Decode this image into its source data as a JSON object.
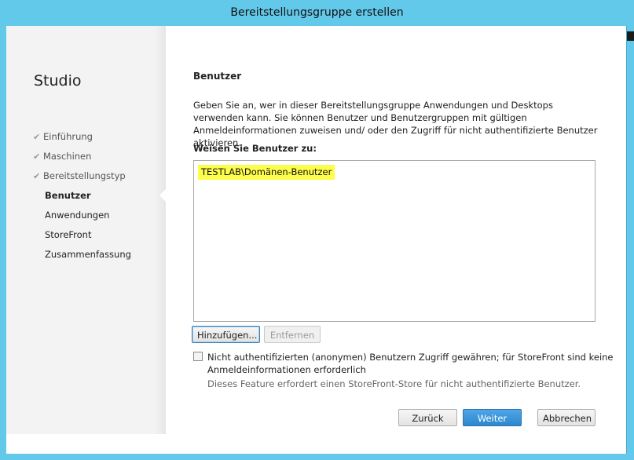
{
  "window": {
    "title": "Bereitstellungsgruppe erstellen"
  },
  "sidebar": {
    "brand": "Studio",
    "items": [
      {
        "label": "Einführung",
        "state": "done"
      },
      {
        "label": "Maschinen",
        "state": "done"
      },
      {
        "label": "Bereitstellungstyp",
        "state": "done"
      },
      {
        "label": "Benutzer",
        "state": "current"
      },
      {
        "label": "Anwendungen",
        "state": "pending"
      },
      {
        "label": "StoreFront",
        "state": "pending"
      },
      {
        "label": "Zusammenfassung",
        "state": "pending"
      }
    ]
  },
  "main": {
    "section_title": "Benutzer",
    "description": "Geben Sie an, wer in dieser Bereitstellungsgruppe Anwendungen und Desktops verwenden kann. Sie können Benutzer und Benutzergruppen mit gültigen Anmeldeinformationen zuweisen und/ oder den Zugriff für nicht authentifizierte Benutzer aktivieren.",
    "assign_label": "Weisen Sie Benutzer zu:",
    "users": [
      "TESTLAB\\Domänen-Benutzer"
    ],
    "add_button": "Hinzufügen...",
    "remove_button": "Entfernen",
    "anonymous": {
      "checked": false,
      "label": "Nicht authentifizierten (anonymen) Benutzern Zugriff gewähren; für StoreFront sind keine Anmeldeinformationen erforderlich",
      "hint": "Dieses Feature erfordert einen StoreFront-Store für nicht authentifizierte Benutzer."
    }
  },
  "footer": {
    "back_button": "Zurück",
    "next_button": "Weiter",
    "cancel_button": "Abbrechen"
  },
  "colors": {
    "title_bar": "#62c9ea",
    "highlight": "#fdfd4b",
    "primary_button": "#2d87cf"
  }
}
